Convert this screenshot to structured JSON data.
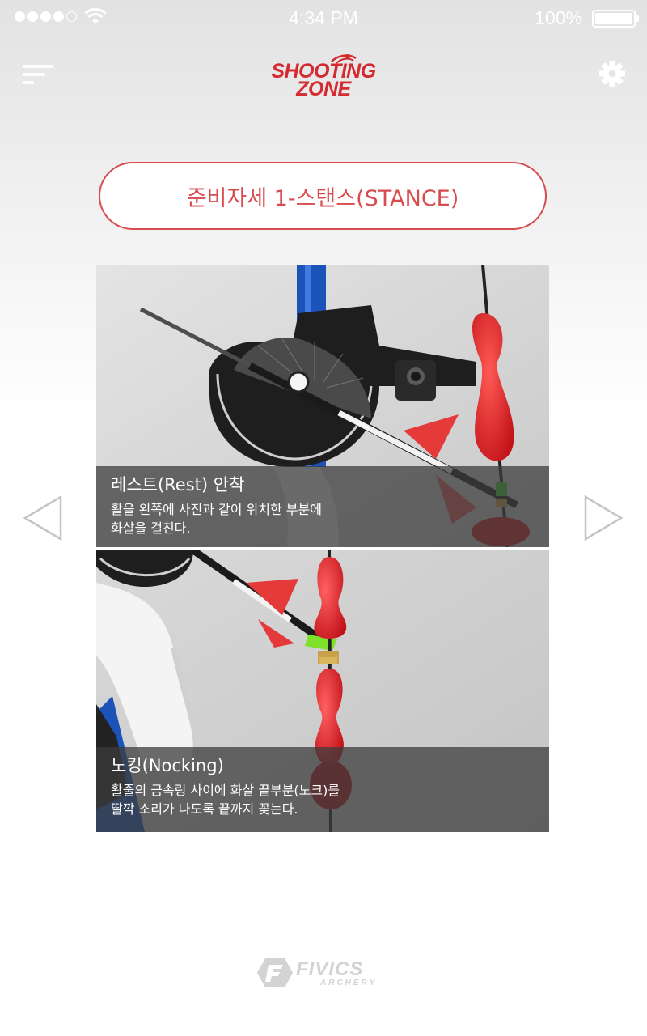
{
  "status_bar": {
    "time": "4:34 PM",
    "battery": "100%",
    "signal_filled": 4,
    "signal_total": 5
  },
  "header": {
    "logo_line1": "SHOOTING",
    "logo_line2": "ZONE",
    "menu_icon": "hamburger-menu-icon",
    "settings_icon": "gear-icon"
  },
  "title": "준비자세 1-스탠스(STANCE)",
  "steps": [
    {
      "title": "레스트(Rest) 안착",
      "desc_line1": "활을 왼쪽에 사진과 같이 위치한 부분에",
      "desc_line2": "화살을 걸친다."
    },
    {
      "title": "노킹(Nocking)",
      "desc_line1": "활줄의 금속링 사이에 화살 끝부분(노크)를",
      "desc_line2": "딸깍 소리가 나도록 끝까지 꽂는다."
    }
  ],
  "navigation": {
    "prev_icon": "triangle-left-icon",
    "next_icon": "triangle-right-icon"
  },
  "footer": {
    "brand_name": "FIVICS",
    "brand_sub": "ARCHERY"
  },
  "colors": {
    "accent": "#d84b4f",
    "logo_red": "#d42a30",
    "caption_bg": "#3c3c3c"
  }
}
